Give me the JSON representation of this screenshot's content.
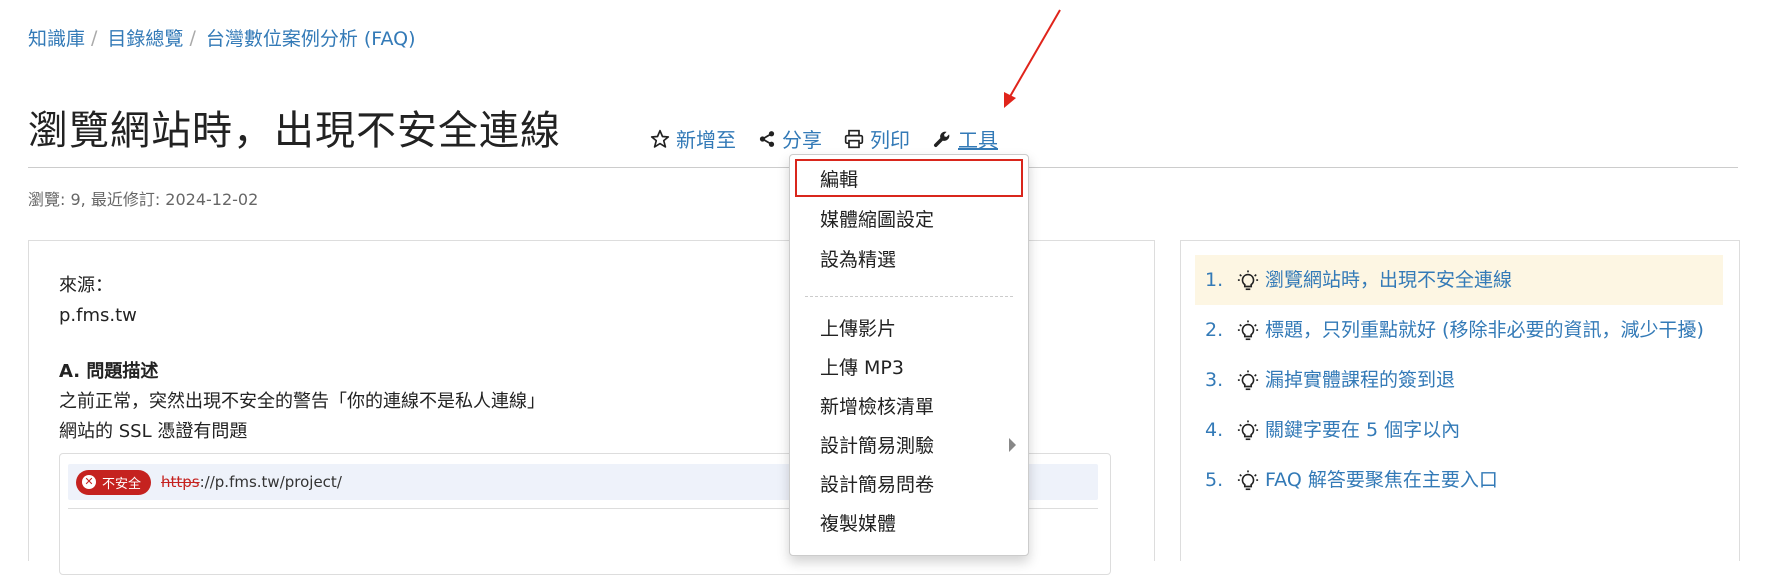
{
  "breadcrumb": {
    "items": [
      "知識庫",
      "目錄總覽",
      "台灣數位案例分析 (FAQ)"
    ],
    "separator": "/"
  },
  "page": {
    "title": "瀏覽網站時，出現不安全連線",
    "meta": "瀏覽: 9, 最近修訂: 2024-12-02"
  },
  "actions": {
    "add_to": "新增至",
    "share": "分享",
    "print": "列印",
    "tools": "工具"
  },
  "content": {
    "source_label": "來源：",
    "source_value": "p.fms.tw",
    "section_a": "A. 問題描述",
    "line1": "之前正常，突然出現不安全的警告「你的連線不是私人連線」",
    "line2": "網站的 SSL 憑證有問題",
    "screenshot": {
      "badge": "不安全",
      "https": "https",
      "url_rest": "://p.fms.tw/project/"
    }
  },
  "dropdown": {
    "items": [
      "編輯",
      "媒體縮圖設定",
      "設為精選",
      "上傳影片",
      "上傳 MP3",
      "新增檢核清單",
      "設計簡易測驗",
      "設計簡易問卷",
      "複製媒體"
    ]
  },
  "sidebar": {
    "items": [
      {
        "num": "1.",
        "text": "瀏覽網站時，出現不安全連線"
      },
      {
        "num": "2.",
        "text": "標題，只列重點就好 (移除非必要的資訊，減少干擾)"
      },
      {
        "num": "3.",
        "text": "漏掉實體課程的簽到退"
      },
      {
        "num": "4.",
        "text": "關鍵字要在 5 個字以內"
      },
      {
        "num": "5.",
        "text": "FAQ 解答要聚焦在主要入口"
      }
    ]
  },
  "colors": {
    "link": "#337ab7",
    "highlight": "#d9261c",
    "active_bg": "#fdf6e3"
  }
}
